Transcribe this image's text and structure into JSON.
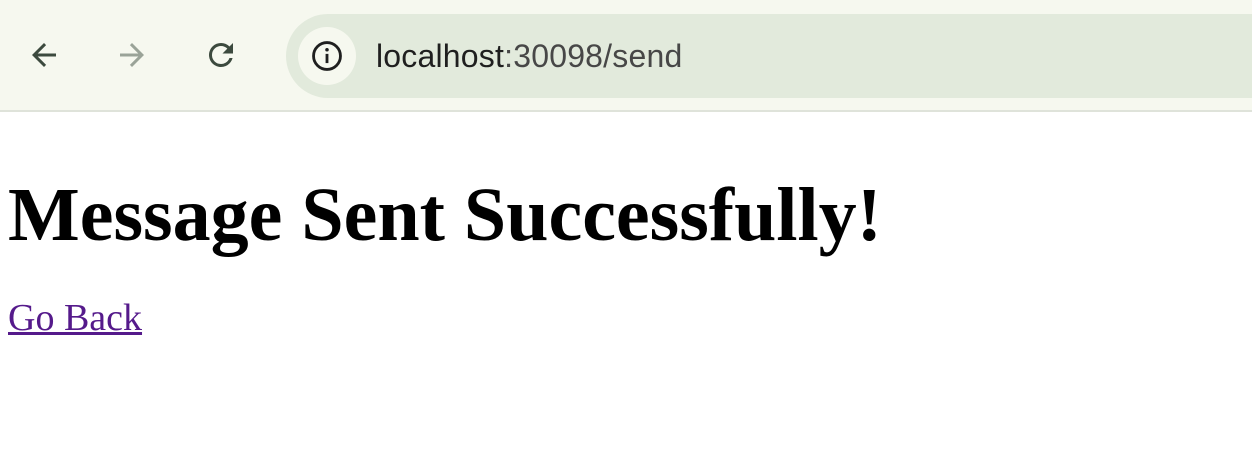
{
  "browser": {
    "back_icon": "arrow-left-icon",
    "forward_icon": "arrow-right-icon",
    "reload_icon": "reload-icon",
    "site_info_icon": "info-icon",
    "url_host": "localhost",
    "url_rest": ":30098/send"
  },
  "page": {
    "heading": "Message Sent Successfully!",
    "link_label": "Go Back"
  },
  "colors": {
    "toolbar_bg": "#f6f8ef",
    "omnibox_bg": "#e2eadc",
    "visited_link": "#551a8b"
  }
}
